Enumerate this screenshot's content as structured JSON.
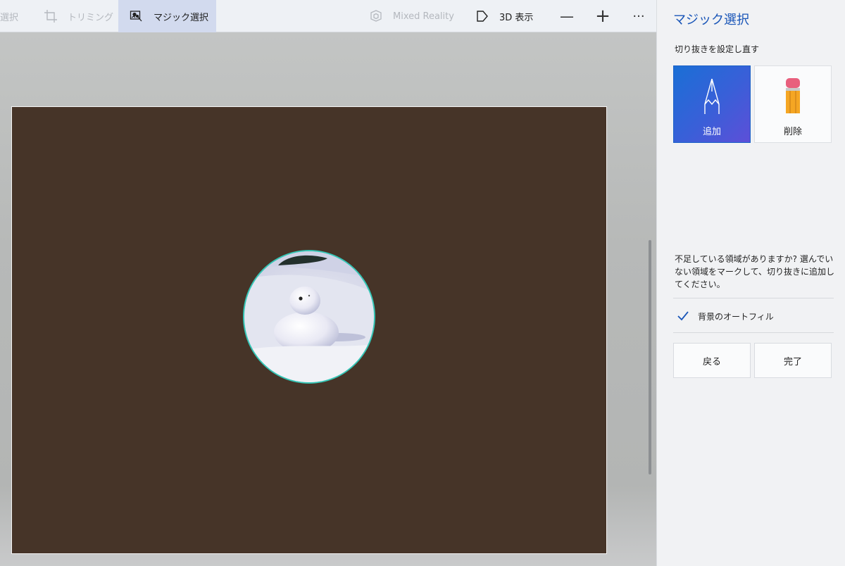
{
  "toolbar": {
    "select_label": "選択",
    "trim_label": "トリミング",
    "magic_label": "マジック選択",
    "mixed_reality_label": "Mixed Reality",
    "view3d_label": "3D 表示",
    "zoom_out_glyph": "—",
    "zoom_in_glyph": "+",
    "more_glyph": "···"
  },
  "panel": {
    "title": "マジック選択",
    "refine_label": "切り抜きを設定し直す",
    "add_label": "追加",
    "remove_label": "削除",
    "help_text": "不足している領域がありますか? 選んでいない領域をマークして、切り抜きに追加してください。",
    "autofill_label": "背景のオートフィル",
    "autofill_checked": true,
    "back_label": "戻る",
    "done_label": "完了"
  },
  "colors": {
    "accent": "#1a56b8",
    "selection_outline": "#35c6b6",
    "image_background": "#463428"
  },
  "icons": {
    "trim": "crop-icon",
    "magic": "magic-select-icon",
    "mixed_reality": "mixed-reality-icon",
    "view3d": "view-3d-icon",
    "add": "pen-icon",
    "remove": "eraser-icon",
    "autofill": "checkmark-icon"
  }
}
